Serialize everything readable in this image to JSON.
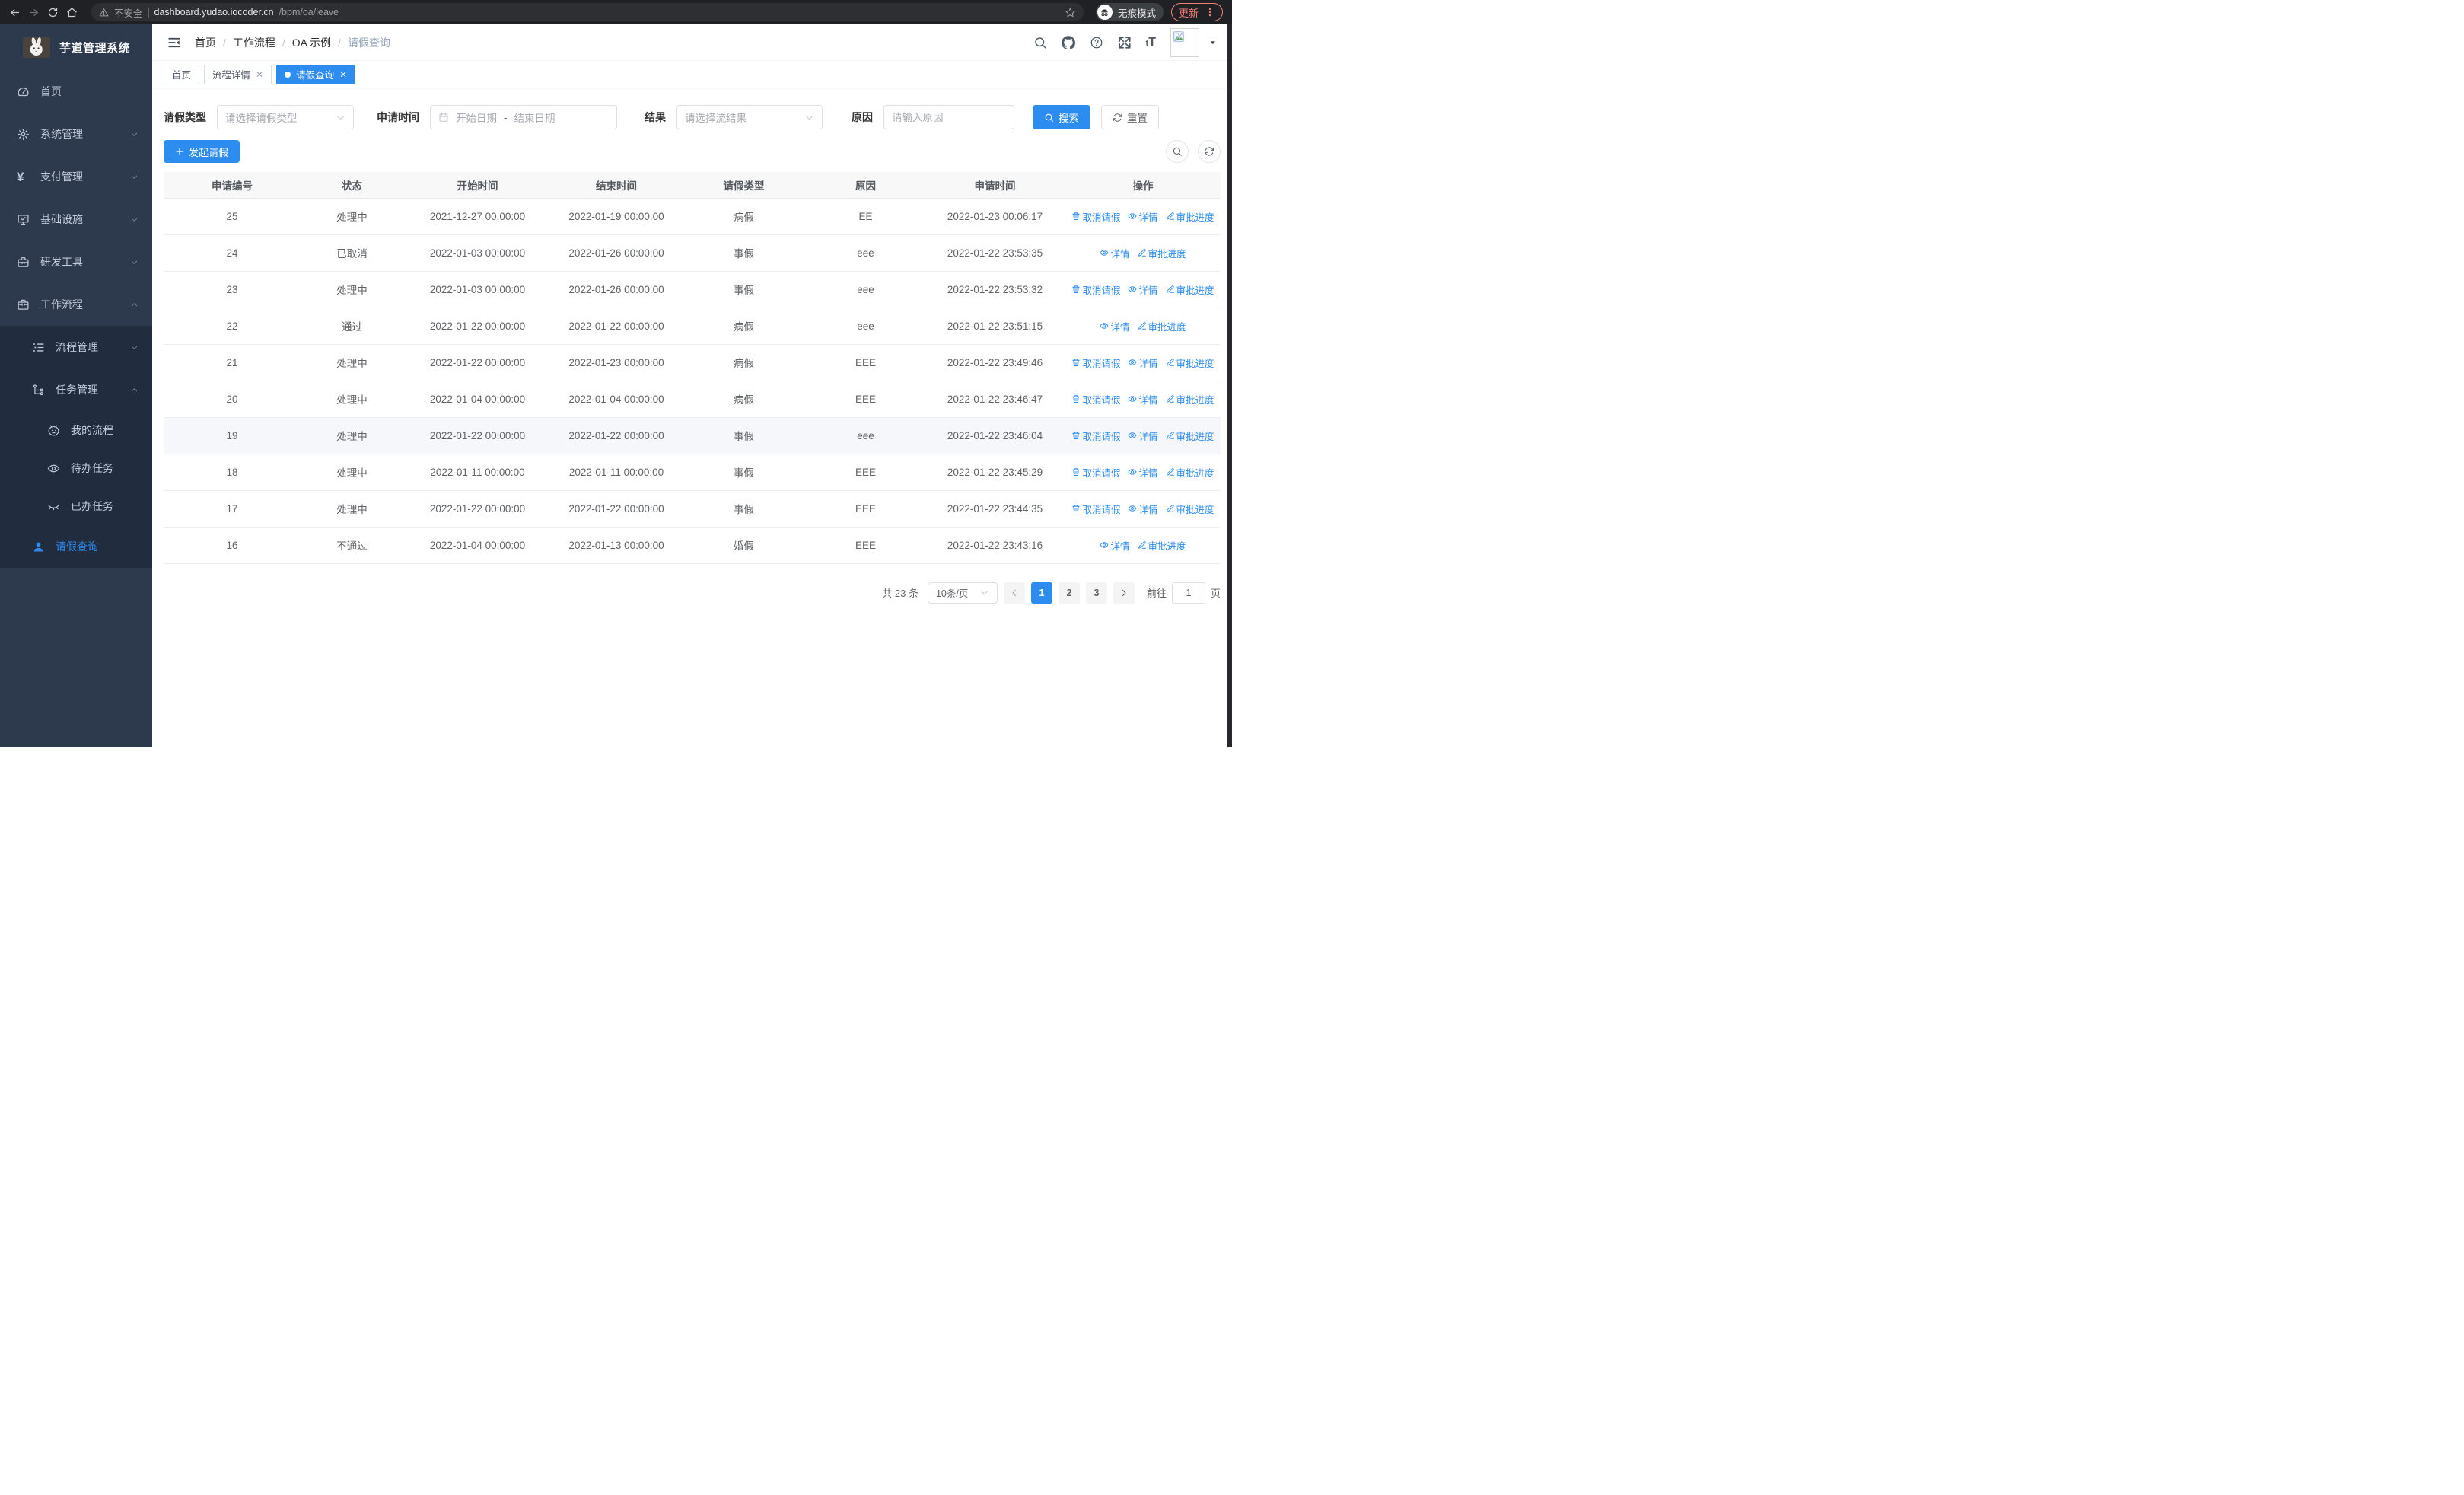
{
  "browser": {
    "security_label": "不安全",
    "url_host": "dashboard.yudao.iocoder.cn",
    "url_path": "/bpm/oa/leave",
    "incognito_label": "无痕模式",
    "update_label": "更新"
  },
  "sidebar": {
    "logo_title": "芋道管理系统",
    "items": [
      {
        "label": "首页",
        "icon": "dashboard-icon"
      },
      {
        "label": "系统管理",
        "icon": "gear-icon"
      },
      {
        "label": "支付管理",
        "icon": "yen-icon"
      },
      {
        "label": "基础设施",
        "icon": "monitor-icon"
      },
      {
        "label": "研发工具",
        "icon": "toolbox-icon"
      },
      {
        "label": "工作流程",
        "icon": "briefcase-icon"
      }
    ],
    "submenu": [
      {
        "label": "流程管理",
        "icon": "flow-icon"
      },
      {
        "label": "任务管理",
        "icon": "tree-icon"
      },
      {
        "label": "我的流程",
        "icon": "face-icon"
      },
      {
        "label": "待办任务",
        "icon": "eye-open-icon"
      },
      {
        "label": "已办任务",
        "icon": "eye-closed-icon"
      },
      {
        "label": "请假查询",
        "icon": "user-icon"
      }
    ]
  },
  "header": {
    "breadcrumb": [
      "首页",
      "工作流程",
      "OA 示例",
      "请假查询"
    ],
    "separator": "/"
  },
  "tabs": [
    {
      "label": "首页"
    },
    {
      "label": "流程详情"
    },
    {
      "label": "请假查询"
    }
  ],
  "filters": {
    "leave_type_label": "请假类型",
    "leave_type_placeholder": "请选择请假类型",
    "apply_time_label": "申请时间",
    "date_start_placeholder": "开始日期",
    "date_separator": "-",
    "date_end_placeholder": "结束日期",
    "result_label": "结果",
    "result_placeholder": "请选择流结果",
    "reason_label": "原因",
    "reason_placeholder": "请输入原因",
    "search_label": "搜索",
    "reset_label": "重置"
  },
  "toolbar": {
    "create_label": "发起请假"
  },
  "table": {
    "columns": [
      "申请编号",
      "状态",
      "开始时间",
      "结束时间",
      "请假类型",
      "原因",
      "申请时间",
      "操作"
    ],
    "action_defs": {
      "cancel": {
        "label": "取消请假",
        "icon": "i-trash"
      },
      "detail": {
        "label": "详情",
        "icon": "i-view"
      },
      "progress": {
        "label": "审批进度",
        "icon": "i-edit"
      }
    },
    "rows": [
      {
        "id": "25",
        "status": "处理中",
        "start": "2021-12-27 00:00:00",
        "end": "2022-01-19 00:00:00",
        "type": "病假",
        "reason": "EE",
        "applied": "2022-01-23 00:06:17",
        "actions": [
          "cancel",
          "detail",
          "progress"
        ]
      },
      {
        "id": "24",
        "status": "已取消",
        "start": "2022-01-03 00:00:00",
        "end": "2022-01-26 00:00:00",
        "type": "事假",
        "reason": "eee",
        "applied": "2022-01-22 23:53:35",
        "actions": [
          "detail",
          "progress"
        ]
      },
      {
        "id": "23",
        "status": "处理中",
        "start": "2022-01-03 00:00:00",
        "end": "2022-01-26 00:00:00",
        "type": "事假",
        "reason": "eee",
        "applied": "2022-01-22 23:53:32",
        "actions": [
          "cancel",
          "detail",
          "progress"
        ]
      },
      {
        "id": "22",
        "status": "通过",
        "start": "2022-01-22 00:00:00",
        "end": "2022-01-22 00:00:00",
        "type": "病假",
        "reason": "eee",
        "applied": "2022-01-22 23:51:15",
        "actions": [
          "detail",
          "progress"
        ]
      },
      {
        "id": "21",
        "status": "处理中",
        "start": "2022-01-22 00:00:00",
        "end": "2022-01-23 00:00:00",
        "type": "病假",
        "reason": "EEE",
        "applied": "2022-01-22 23:49:46",
        "actions": [
          "cancel",
          "detail",
          "progress"
        ]
      },
      {
        "id": "20",
        "status": "处理中",
        "start": "2022-01-04 00:00:00",
        "end": "2022-01-04 00:00:00",
        "type": "病假",
        "reason": "EEE",
        "applied": "2022-01-22 23:46:47",
        "actions": [
          "cancel",
          "detail",
          "progress"
        ]
      },
      {
        "id": "19",
        "status": "处理中",
        "start": "2022-01-22 00:00:00",
        "end": "2022-01-22 00:00:00",
        "type": "事假",
        "reason": "eee",
        "applied": "2022-01-22 23:46:04",
        "actions": [
          "cancel",
          "detail",
          "progress"
        ],
        "highlighted": true
      },
      {
        "id": "18",
        "status": "处理中",
        "start": "2022-01-11 00:00:00",
        "end": "2022-01-11 00:00:00",
        "type": "事假",
        "reason": "EEE",
        "applied": "2022-01-22 23:45:29",
        "actions": [
          "cancel",
          "detail",
          "progress"
        ]
      },
      {
        "id": "17",
        "status": "处理中",
        "start": "2022-01-22 00:00:00",
        "end": "2022-01-22 00:00:00",
        "type": "事假",
        "reason": "EEE",
        "applied": "2022-01-22 23:44:35",
        "actions": [
          "cancel",
          "detail",
          "progress"
        ]
      },
      {
        "id": "16",
        "status": "不通过",
        "start": "2022-01-04 00:00:00",
        "end": "2022-01-13 00:00:00",
        "type": "婚假",
        "reason": "EEE",
        "applied": "2022-01-22 23:43:16",
        "actions": [
          "detail",
          "progress"
        ]
      }
    ]
  },
  "pagination": {
    "total_label": "共 23 条",
    "page_size": "10条/页",
    "pages": [
      "1",
      "2",
      "3"
    ],
    "active_page": "1",
    "goto_label": "前往",
    "goto_value": "1",
    "page_unit": "页"
  },
  "colors": {
    "primary": "#2d8cf0",
    "sidebar_bg": "#2d3a4d",
    "sidebar_submenu_bg": "#212d3f",
    "chrome_bg": "#202124",
    "update_accent": "#ee8277",
    "table_header_bg": "#f8f8f9",
    "row_highlight": "#f5f7fa"
  }
}
